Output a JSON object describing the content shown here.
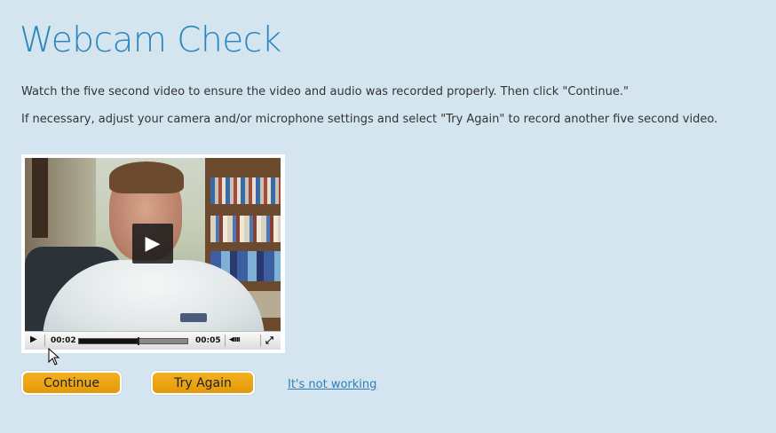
{
  "page": {
    "title": "Webcam Check",
    "instruction_1": "Watch the five second video to ensure the video and audio was recorded properly. Then click \"Continue.\"",
    "instruction_2": "If necessary, adjust your camera and/or microphone settings and select \"Try Again\" to record another five second video."
  },
  "player": {
    "current_time": "00:02",
    "total_time": "00:05",
    "progress": 0.55,
    "volume_glyph": "◂ıııı",
    "play_icon": "play-icon",
    "fullscreen_icon": "fullscreen-icon"
  },
  "actions": {
    "continue_label": "Continue",
    "try_again_label": "Try Again",
    "not_working_label": "It's not working"
  },
  "colors": {
    "background": "#d5e5f0",
    "title": "#2a86bd",
    "button": "#f0a818",
    "link": "#2a7fb8"
  }
}
